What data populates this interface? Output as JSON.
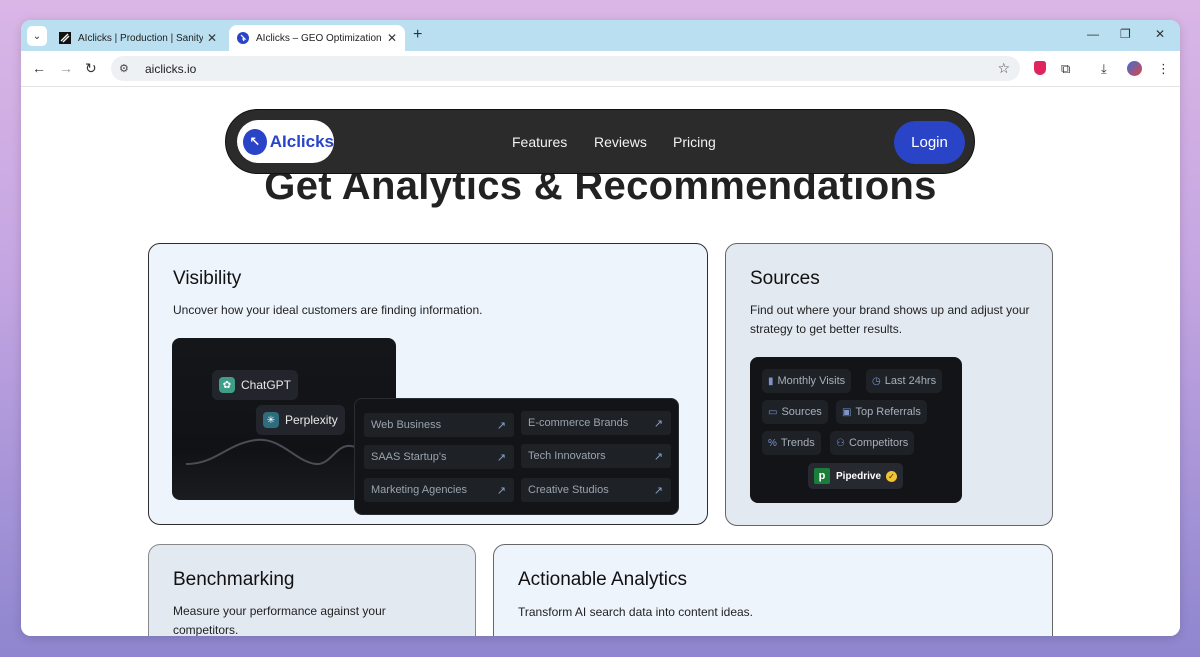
{
  "browser": {
    "tabs": [
      {
        "title": "AIclicks | Production | Sanity",
        "active": false
      },
      {
        "title": "AIclicks – GEO Optimization",
        "active": true
      }
    ],
    "new_tab": "+",
    "url": "aiclicks.io",
    "window_controls": {
      "minimize": "—",
      "restore": "❐",
      "close": "✕"
    },
    "tab_close": "✕",
    "tab_dropdown": "⌄",
    "nav": {
      "back": "←",
      "forward": "→",
      "reload": "↻"
    },
    "icons": {
      "bookmark": "☆",
      "extensions": "⧉",
      "download": "⤓",
      "menu": "⋮",
      "site_info": "⚙"
    }
  },
  "site": {
    "logo": {
      "mark": "↖",
      "word": "AIclicks",
      "brand_color": "#2a44c7"
    },
    "nav_links": [
      "Features",
      "Reviews",
      "Pricing"
    ],
    "login_label": "Login",
    "hero_title": "Get Analytics & Recommendations"
  },
  "cards": {
    "visibility": {
      "title": "Visibility",
      "description": "Uncover how your ideal customers are finding information.",
      "llm_chips": [
        {
          "label": "ChatGPT",
          "icon": "chatgpt-icon"
        },
        {
          "label": "Perplexity",
          "icon": "perplexity-icon"
        }
      ],
      "segments": [
        {
          "label": "Web Business"
        },
        {
          "label": "E-commerce Brands"
        },
        {
          "label": "SAAS Startup's"
        },
        {
          "label": "Tech Innovators"
        },
        {
          "label": "Marketing Agencies"
        },
        {
          "label": "Creative Studios"
        }
      ],
      "trend_arrow": "↗"
    },
    "sources": {
      "title": "Sources",
      "description": "Find out where your brand shows up and adjust your strategy to get better results.",
      "pills": [
        {
          "label": "Monthly Visits",
          "icon": "bar-chart-icon",
          "glyph": "▮"
        },
        {
          "label": "Last 24hrs",
          "icon": "clock-icon",
          "glyph": "◷"
        },
        {
          "label": "Sources",
          "icon": "card-icon",
          "glyph": "▭"
        },
        {
          "label": "Top Referrals",
          "icon": "money-icon",
          "glyph": "▣"
        },
        {
          "label": "Trends",
          "icon": "percent-icon",
          "glyph": "%"
        },
        {
          "label": "Competitors",
          "icon": "people-icon",
          "glyph": "⚇"
        }
      ],
      "brand_badge": {
        "mark": "p",
        "label": "Pipedrive",
        "verified": "✓"
      }
    },
    "benchmarking": {
      "title": "Benchmarking",
      "description": "Measure your performance against your competitors."
    },
    "actionable": {
      "title": "Actionable Analytics",
      "description": "Transform AI search data into content ideas."
    }
  }
}
